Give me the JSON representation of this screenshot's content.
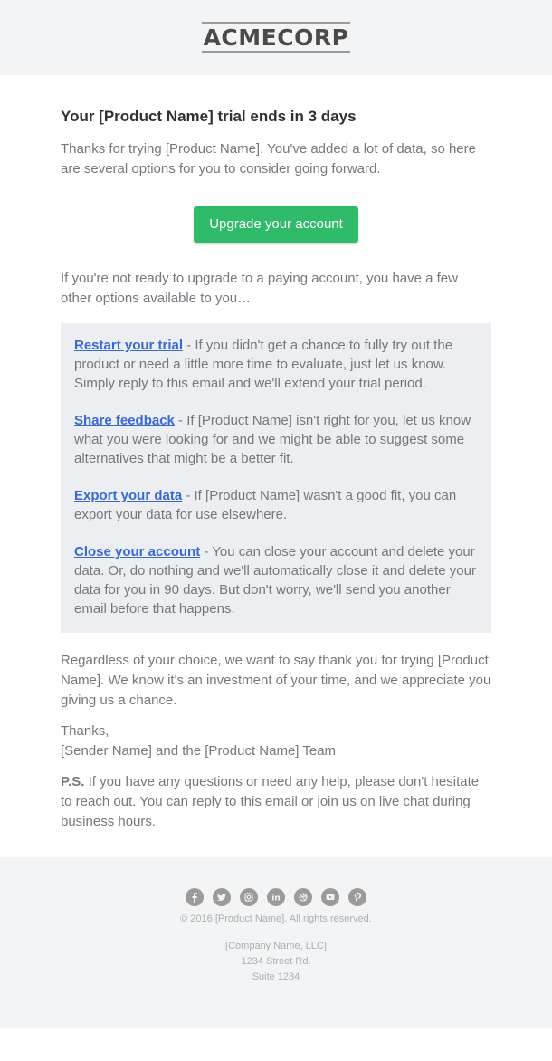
{
  "header": {
    "logo_text": "ACMECORP"
  },
  "main": {
    "title": "Your [Product Name] trial ends in 3 days",
    "intro": "Thanks for trying [Product Name]. You've added a lot of data, so here are several options for you to consider going forward.",
    "cta_label": "Upgrade your account",
    "pre_options": "If you're not ready to upgrade to a paying account, you have a few other options available to you…",
    "options": [
      {
        "link": "Restart your trial",
        "text": " - If you didn't get a chance to fully try out the product or need a little more time to evaluate, just let us know. Simply reply to this email and we'll extend your trial period."
      },
      {
        "link": "Share feedback",
        "text": " - If [Product Name] isn't right for you, let us know what you were looking for and we might be able to suggest some alternatives that might be a better fit."
      },
      {
        "link": "Export your data",
        "text": " - If [Product Name] wasn't a good fit, you can export your data for use elsewhere."
      },
      {
        "link": "Close your account",
        "text": " - You can close your account and delete your data. Or, do nothing and we'll automatically close it and delete your data for you in 90 days. But don't worry, we'll send you another email before that happens."
      }
    ],
    "closing": "Regardless of your choice, we want to say thank you for trying [Product Name]. We know it's an investment of your time, and we appreciate you giving us a chance.",
    "signoff": "Thanks,",
    "sender": "[Sender Name] and the [Product Name] Team",
    "ps_label": "P.S.",
    "ps_text": " If you have any questions or need any help, please don't hesitate to reach out. You can reply to this email or join us on live chat during business hours."
  },
  "footer": {
    "socials": [
      "facebook-icon",
      "twitter-icon",
      "instagram-icon",
      "linkedin-icon",
      "dribbble-icon",
      "youtube-icon",
      "pinterest-icon"
    ],
    "copyright": "© 2016 [Product Name]. All rights reserved.",
    "address": [
      "[Company Name, LLC]",
      "1234 Street Rd.",
      "Suite 1234"
    ]
  },
  "colors": {
    "accent": "#2fbb6a",
    "link": "#3869d4",
    "panel": "#edeef2",
    "header_bg": "#f2f4f6"
  }
}
